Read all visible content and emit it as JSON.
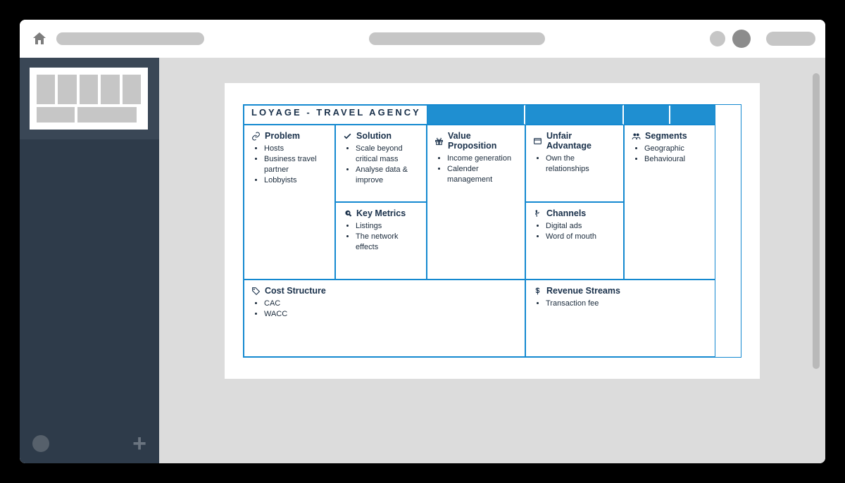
{
  "canvas": {
    "title": "LOYAGE - TRAVEL AGENCY",
    "tabs": [
      "",
      "",
      "",
      ""
    ],
    "problem": {
      "label": "Problem",
      "items": [
        "Hosts",
        "Business travel partner",
        "Lobbyists"
      ]
    },
    "solution": {
      "label": "Solution",
      "items": [
        "Scale beyond critical mass",
        "Analyse data & improve"
      ]
    },
    "metrics": {
      "label": "Key Metrics",
      "items": [
        "Listings",
        "The network effects"
      ]
    },
    "valueprop": {
      "label": "Value Proposition",
      "items": [
        "Income generation",
        "Calender management"
      ]
    },
    "advantage": {
      "label": "Unfair Advantage",
      "items": [
        "Own the relationships"
      ]
    },
    "channels": {
      "label": "Channels",
      "items": [
        "Digital ads",
        "Word of mouth"
      ]
    },
    "segments": {
      "label": "Segments",
      "items": [
        "Geographic",
        "Behavioural"
      ]
    },
    "cost": {
      "label": "Cost Structure",
      "items": [
        "CAC",
        "WACC"
      ]
    },
    "revenue": {
      "label": "Revenue Streams",
      "items": [
        "Transaction fee"
      ]
    }
  }
}
